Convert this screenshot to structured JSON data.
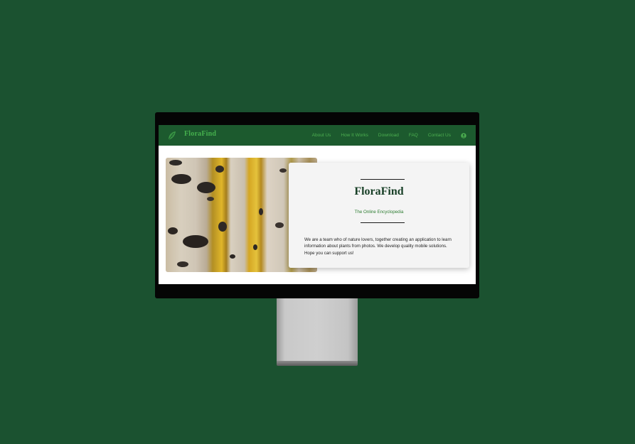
{
  "site": {
    "brand": "FloraFind",
    "nav_items": [
      "About Us",
      "How It Works",
      "Download",
      "FAQ",
      "Contact Us"
    ]
  },
  "hero": {
    "title": "FloraFind",
    "subtitle": "The Online Encyclopedia",
    "description": "We are a team who of nature lovers, together creating an application to learn information about plants from photos. We develop quality mobile solutions. Hope you can support us!"
  },
  "icons": {
    "logo": "leaf-logo-icon",
    "account": "user-circle-icon"
  },
  "colors": {
    "background": "#1b5230",
    "navbar": "#1c5a2e",
    "accent": "#4caf50",
    "title": "#173f26"
  }
}
